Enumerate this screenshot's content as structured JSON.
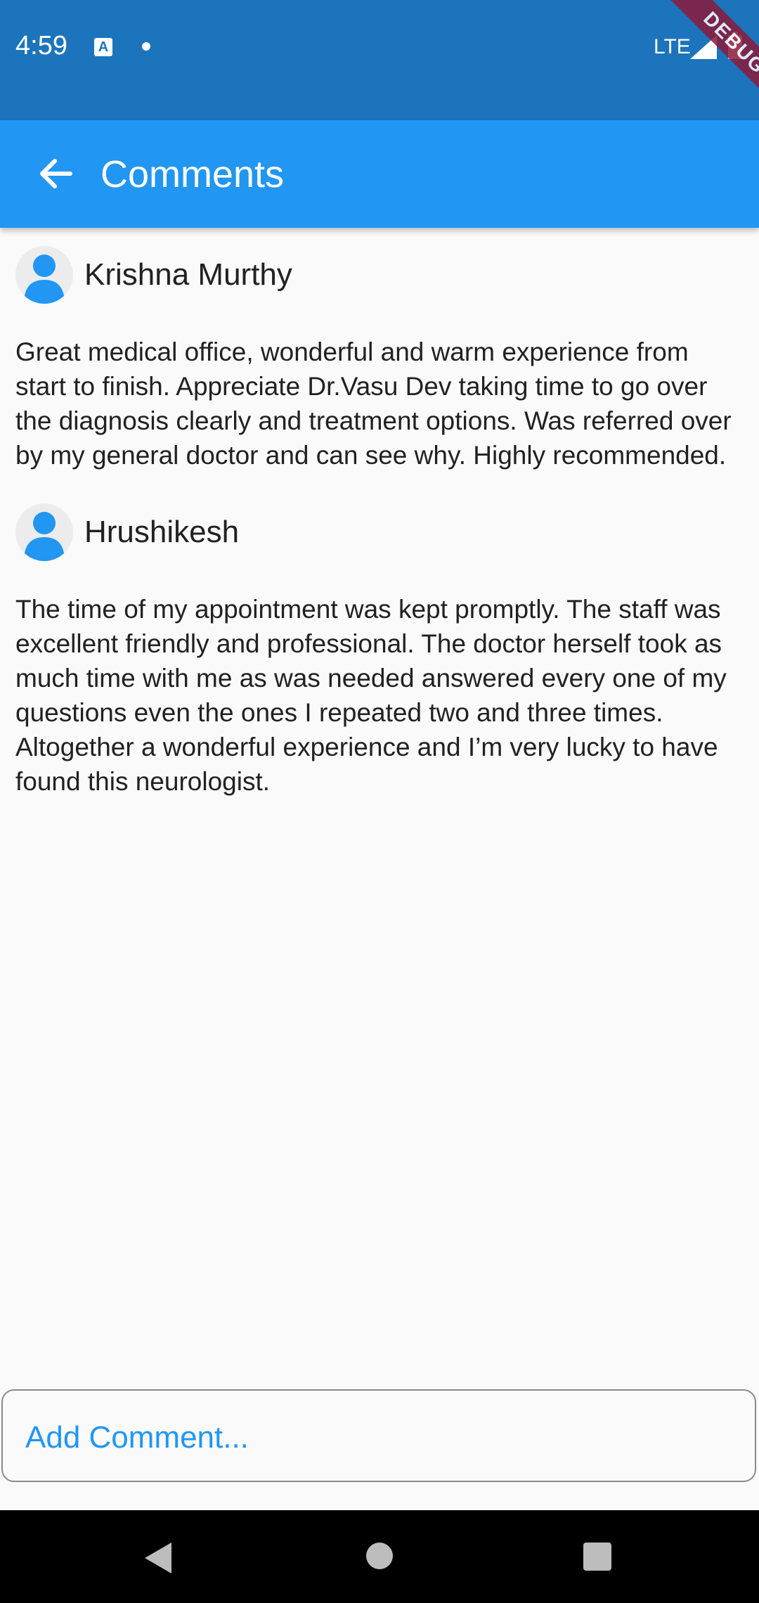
{
  "status_bar": {
    "time": "4:59",
    "network": "LTE",
    "icons": [
      "app-a-icon",
      "notification-dot-icon",
      "signal-icon",
      "battery-icon"
    ]
  },
  "debug_banner": "DEBUG",
  "app_bar": {
    "back_icon": "arrow-back-icon",
    "title": "Comments"
  },
  "comments": [
    {
      "author": "Krishna Murthy",
      "avatar_icon": "person-icon",
      "text": "Great medical office, wonderful and warm experience from start to finish. Appreciate Dr.Vasu Dev taking time to go over the diagnosis clearly and treatment options. Was referred over by my general doctor and can see why. Highly recommended."
    },
    {
      "author": "Hrushikesh",
      "avatar_icon": "person-icon",
      "text": "The time of my appointment was kept promptly. The staff was excellent friendly and professional. The doctor herself took as much time with me as was needed answered every one of my questions even the ones I repeated two and three times. Altogether a wonderful experience and I’m very lucky to have found this neurologist."
    }
  ],
  "add_comment": {
    "placeholder": "Add Comment...",
    "value": ""
  },
  "nav_bar": {
    "icons": [
      "nav-back-icon",
      "nav-home-icon",
      "nav-recents-icon"
    ]
  },
  "colors": {
    "status_bar": "#1c74bc",
    "app_bar": "#2196f3",
    "accent": "#2196f3",
    "background": "#fafafa",
    "text": "#212121",
    "debug_ribbon": "#8b1a3a"
  }
}
